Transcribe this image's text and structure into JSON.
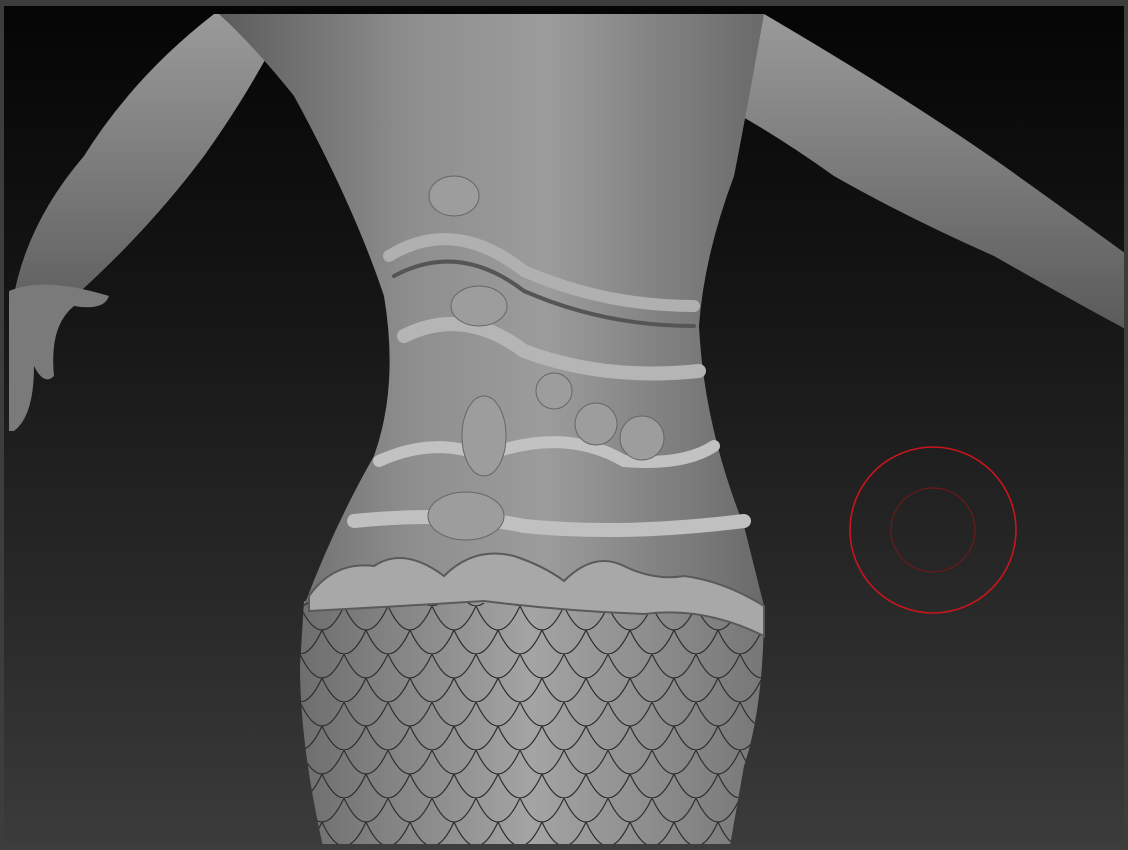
{
  "viewport": {
    "background_top": "#050505",
    "background_bottom": "#3b3b3b",
    "model_color": "#8a8a8a",
    "model_highlight": "#c4c4c4"
  },
  "brush_cursor": {
    "icon": "brush-cursor-icon",
    "outer_color": "#c8161c",
    "inner_color": "#6a1a1a"
  }
}
